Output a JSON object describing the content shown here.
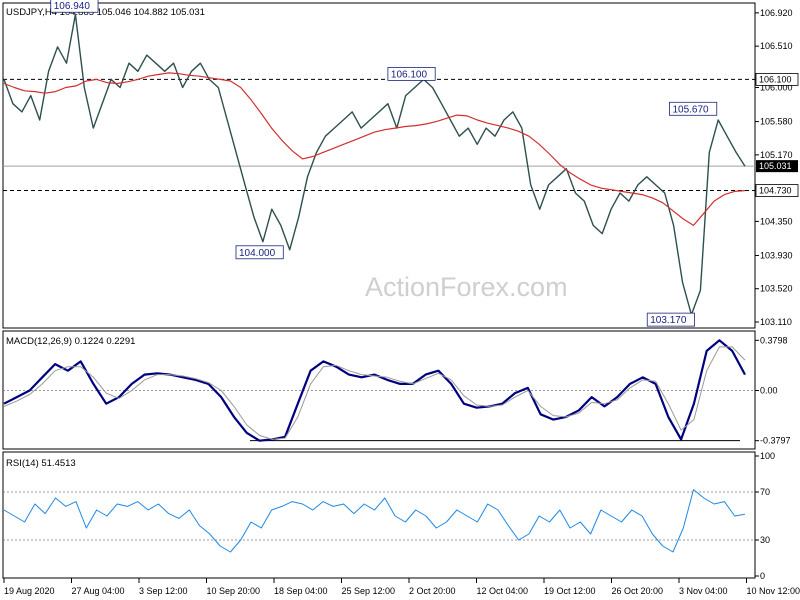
{
  "chart_data": {
    "type": "line",
    "symbol_header": "USDJPY,H4  104.885 105.046 104.882 105.031",
    "watermark": "ActionForex.com",
    "x_labels": [
      "19 Aug 2020",
      "27 Aug 04:00",
      "3 Sep 12:00",
      "10 Sep 20:00",
      "18 Sep 04:00",
      "25 Sep 12:00",
      "2 Oct 20:00",
      "12 Oct 04:00",
      "19 Oct 12:00",
      "26 Oct 20:00",
      "3 Nov 04:00",
      "10 Nov 12:00"
    ],
    "price_panel": {
      "y_ticks": [
        "106.920",
        "106.510",
        "106.000",
        "105.580",
        "105.170",
        "104.350",
        "103.930",
        "103.520",
        "103.110"
      ],
      "ylim": [
        103.11,
        106.98
      ],
      "current": "105.031",
      "levels": [
        {
          "label": "106.100",
          "value": 106.1,
          "style": "dashed"
        },
        {
          "label": "104.730",
          "value": 104.73,
          "style": "dashed"
        }
      ],
      "callouts": [
        {
          "label": "106.940",
          "value": 106.94,
          "at": 0.095
        },
        {
          "label": "104.000",
          "value": 104.0,
          "at": 0.345
        },
        {
          "label": "106.100",
          "value": 106.1,
          "at": 0.55
        },
        {
          "label": "105.670",
          "value": 105.67,
          "at": 0.93
        },
        {
          "label": "103.170",
          "value": 103.17,
          "at": 0.9
        }
      ],
      "series": [
        {
          "values": [
            106.1,
            105.8,
            105.7,
            105.9,
            105.6,
            106.2,
            106.5,
            106.3,
            106.9,
            106.0,
            105.5,
            105.8,
            106.1,
            106.0,
            106.3,
            106.2,
            106.4,
            106.3,
            106.2,
            106.3,
            106.0,
            106.2,
            106.3,
            106.1,
            106.0,
            105.6,
            105.2,
            104.8,
            104.4,
            104.1,
            104.5,
            104.3,
            104.0,
            104.4,
            104.9,
            105.2,
            105.4,
            105.5,
            105.6,
            105.7,
            105.5,
            105.6,
            105.7,
            105.8,
            105.5,
            105.9,
            106.0,
            106.1,
            106.0,
            105.8,
            105.6,
            105.4,
            105.5,
            105.3,
            105.5,
            105.4,
            105.6,
            105.7,
            105.5,
            104.8,
            104.5,
            104.8,
            104.9,
            105.0,
            104.7,
            104.6,
            104.3,
            104.2,
            104.5,
            104.7,
            104.6,
            104.8,
            104.9,
            104.8,
            104.7,
            104.3,
            103.6,
            103.2,
            103.5,
            105.2,
            105.6,
            105.4,
            105.2,
            105.03
          ],
          "color": "#2f4f4f"
        },
        {
          "name": "MA",
          "values": [
            106.05,
            106.0,
            105.96,
            105.95,
            105.93,
            105.95,
            106.0,
            106.02,
            106.08,
            106.1,
            106.06,
            106.05,
            106.07,
            106.1,
            106.14,
            106.16,
            106.18,
            106.17,
            106.15,
            106.14,
            106.12,
            106.1,
            106.08,
            106.0,
            105.85,
            105.68,
            105.5,
            105.35,
            105.22,
            105.12,
            105.15,
            105.2,
            105.25,
            105.3,
            105.35,
            105.4,
            105.45,
            105.48,
            105.5,
            105.52,
            105.53,
            105.55,
            105.58,
            105.62,
            105.66,
            105.65,
            105.6,
            105.56,
            105.53,
            105.5,
            105.46,
            105.4,
            105.3,
            105.18,
            105.05,
            104.95,
            104.87,
            104.8,
            104.76,
            104.74,
            104.72,
            104.7,
            104.68,
            104.64,
            104.58,
            104.48,
            104.38,
            104.3,
            104.45,
            104.6,
            104.68,
            104.72,
            104.73
          ],
          "color": "#d32f2f"
        }
      ]
    },
    "macd_panel": {
      "label": "MACD(12,26,9) 0.1224 0.2291",
      "y_ticks": [
        "0.3798",
        "0.00",
        "-0.3797"
      ],
      "ylim": [
        -0.42,
        0.42
      ],
      "zero": 0,
      "support": -0.3797,
      "series": [
        {
          "values": [
            -0.1,
            -0.05,
            0.0,
            0.1,
            0.2,
            0.15,
            0.22,
            0.05,
            -0.1,
            -0.05,
            0.05,
            0.12,
            0.13,
            0.12,
            0.1,
            0.08,
            0.05,
            -0.05,
            -0.2,
            -0.32,
            -0.38,
            -0.37,
            -0.35,
            -0.1,
            0.15,
            0.22,
            0.18,
            0.12,
            0.1,
            0.12,
            0.08,
            0.05,
            0.05,
            0.12,
            0.15,
            0.05,
            -0.1,
            -0.13,
            -0.12,
            -0.1,
            -0.02,
            0.02,
            -0.18,
            -0.22,
            -0.2,
            -0.15,
            -0.05,
            -0.12,
            -0.05,
            0.05,
            0.1,
            0.05,
            -0.2,
            -0.37,
            -0.1,
            0.3,
            0.38,
            0.3,
            0.12
          ],
          "color": "#000080"
        },
        {
          "values": [
            -0.12,
            -0.08,
            -0.03,
            0.05,
            0.15,
            0.18,
            0.18,
            0.1,
            -0.02,
            -0.06,
            0.0,
            0.08,
            0.12,
            0.12,
            0.11,
            0.09,
            0.06,
            0.0,
            -0.12,
            -0.26,
            -0.34,
            -0.37,
            -0.36,
            -0.2,
            0.05,
            0.18,
            0.19,
            0.15,
            0.12,
            0.11,
            0.1,
            0.07,
            0.05,
            0.09,
            0.13,
            0.08,
            -0.04,
            -0.11,
            -0.12,
            -0.11,
            -0.05,
            0.0,
            -0.12,
            -0.19,
            -0.2,
            -0.17,
            -0.09,
            -0.1,
            -0.07,
            0.02,
            0.08,
            0.07,
            -0.1,
            -0.3,
            -0.22,
            0.15,
            0.33,
            0.33,
            0.23
          ],
          "color": "#999999"
        }
      ]
    },
    "rsi_panel": {
      "label": "RSI(14) 51.4513",
      "y_ticks": [
        "100",
        "70",
        "30",
        "0"
      ],
      "ylim": [
        0,
        100
      ],
      "levels": [
        70,
        30
      ],
      "series": [
        {
          "values": [
            55,
            50,
            45,
            60,
            52,
            65,
            58,
            62,
            40,
            55,
            50,
            60,
            58,
            62,
            55,
            60,
            52,
            48,
            55,
            42,
            35,
            25,
            20,
            30,
            45,
            40,
            55,
            58,
            62,
            60,
            55,
            62,
            58,
            60,
            52,
            60,
            55,
            65,
            50,
            45,
            55,
            50,
            40,
            45,
            55,
            50,
            45,
            60,
            55,
            42,
            30,
            35,
            50,
            45,
            55,
            40,
            45,
            35,
            55,
            50,
            45,
            55,
            50,
            35,
            25,
            20,
            40,
            72,
            65,
            60,
            62,
            50,
            51.45
          ],
          "color": "#1e88e5"
        }
      ]
    },
    "colors": {
      "price_bars": "#2f4f4f",
      "ma": "#d32f2f",
      "macd": "#000080",
      "signal": "#999999",
      "rsi": "#1e88e5",
      "callout_text": "#1a237e",
      "current_tag_bg": "#000000",
      "grid": "#000000"
    }
  }
}
